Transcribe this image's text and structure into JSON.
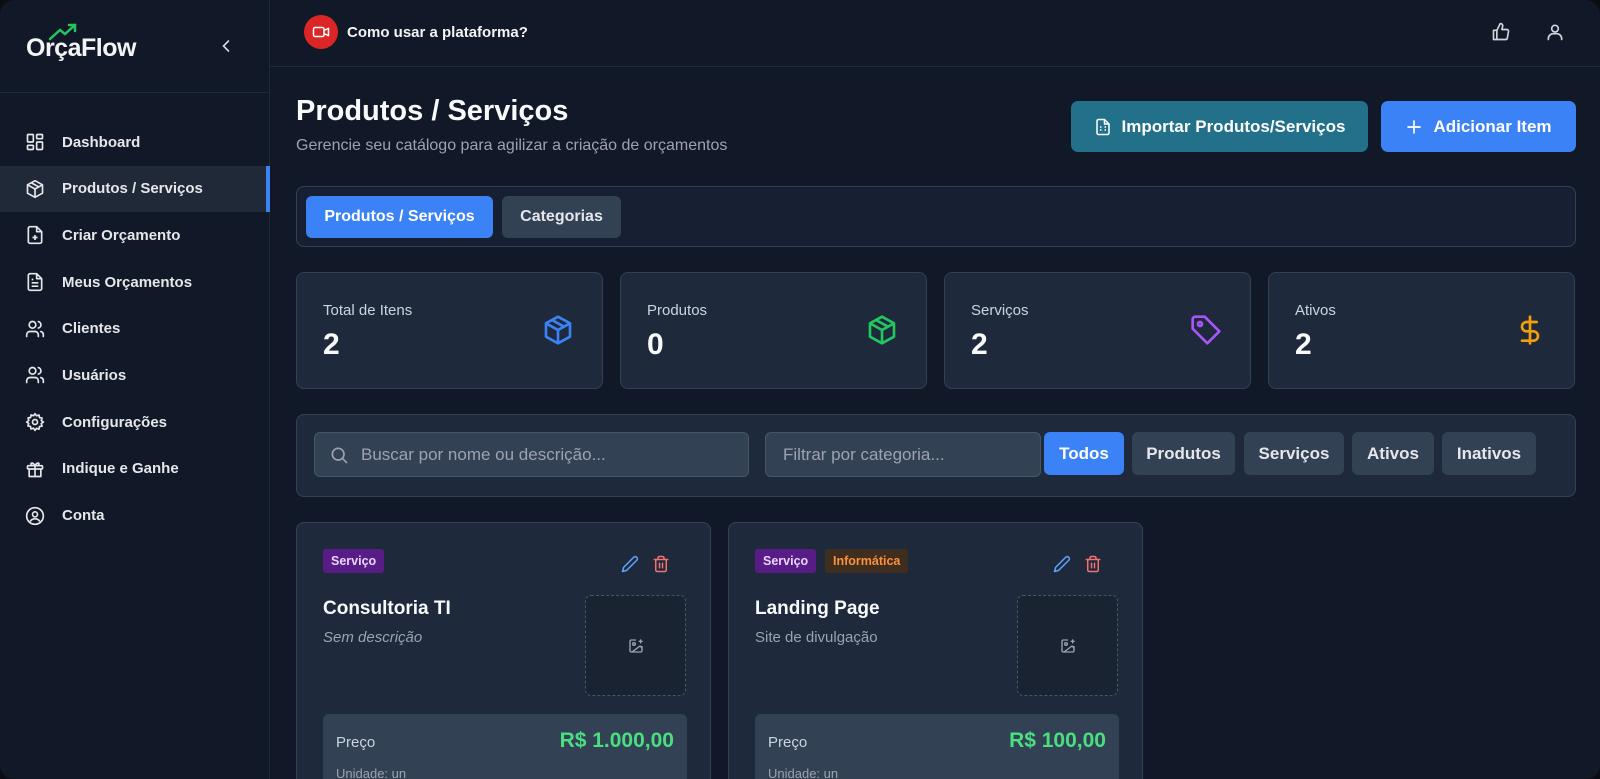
{
  "brand": {
    "name": "OrçaFlow"
  },
  "sidebar": {
    "items": [
      {
        "label": "Dashboard",
        "icon": "dashboard-icon",
        "active": false
      },
      {
        "label": "Produtos / Serviços",
        "icon": "box-icon",
        "active": true
      },
      {
        "label": "Criar Orçamento",
        "icon": "file-plus-icon",
        "active": false
      },
      {
        "label": "Meus Orçamentos",
        "icon": "file-text-icon",
        "active": false
      },
      {
        "label": "Clientes",
        "icon": "users-icon",
        "active": false
      },
      {
        "label": "Usuários",
        "icon": "user-group-icon",
        "active": false
      },
      {
        "label": "Configurações",
        "icon": "gear-icon",
        "active": false
      },
      {
        "label": "Indique e Ganhe",
        "icon": "gift-icon",
        "active": false
      },
      {
        "label": "Conta",
        "icon": "user-circle-icon",
        "active": false
      }
    ]
  },
  "topbar": {
    "help_label": "Como usar a plataforma?"
  },
  "header": {
    "title": "Produtos / Serviços",
    "subtitle": "Gerencie seu catálogo para agilizar a criação de orçamentos",
    "import_label": "Importar Produtos/Serviços",
    "add_label": "Adicionar Item"
  },
  "tabs": [
    {
      "label": "Produtos / Serviços",
      "active": true
    },
    {
      "label": "Categorias",
      "active": false
    }
  ],
  "stats": [
    {
      "label": "Total de Itens",
      "value": "2",
      "icon": "box-icon",
      "color": "#3b82f6"
    },
    {
      "label": "Produtos",
      "value": "0",
      "icon": "box-icon",
      "color": "#22c55e"
    },
    {
      "label": "Serviços",
      "value": "2",
      "icon": "tag-icon",
      "color": "#a855f7"
    },
    {
      "label": "Ativos",
      "value": "2",
      "icon": "dollar-icon",
      "color": "#f59e0b"
    }
  ],
  "filters": {
    "search_placeholder": "Buscar por nome ou descrição...",
    "category_placeholder": "Filtrar por categoria...",
    "chips": [
      "Todos",
      "Produtos",
      "Serviços",
      "Ativos",
      "Inativos"
    ],
    "active_chip": "Todos"
  },
  "cards": [
    {
      "type": "Serviço",
      "category": "",
      "title": "Consultoria TI",
      "description": "Sem descrição",
      "price_label": "Preço",
      "price": "R$ 1.000,00",
      "unit": "Unidade: un"
    },
    {
      "type": "Serviço",
      "category": "Informática",
      "title": "Landing Page",
      "description": "Site de divulgação",
      "price_label": "Preço",
      "price": "R$ 100,00",
      "unit": "Unidade: un"
    }
  ]
}
